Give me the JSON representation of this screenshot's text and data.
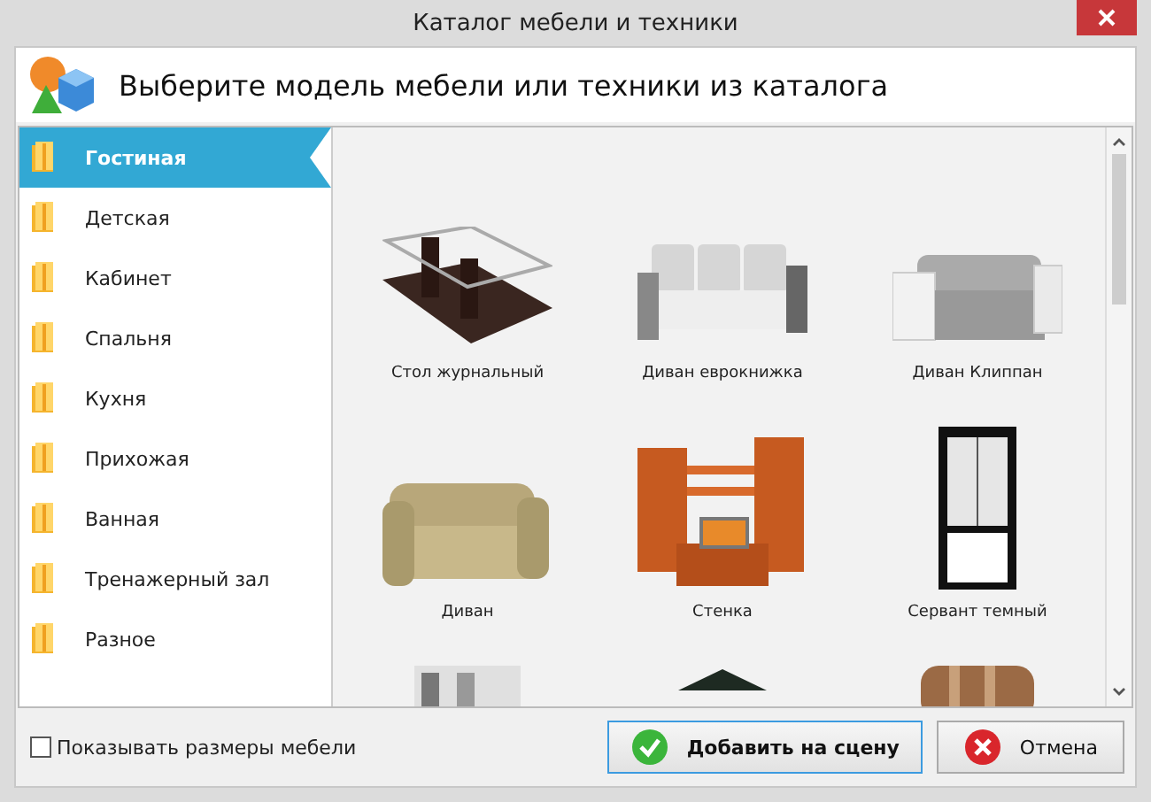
{
  "window": {
    "title": "Каталог мебели и техники"
  },
  "header": {
    "title": "Выберите модель мебели или техники из каталога"
  },
  "sidebar": {
    "items": [
      {
        "label": "Гостиная",
        "selected": true
      },
      {
        "label": "Детская",
        "selected": false
      },
      {
        "label": "Кабинет",
        "selected": false
      },
      {
        "label": "Спальня",
        "selected": false
      },
      {
        "label": "Кухня",
        "selected": false
      },
      {
        "label": "Прихожая",
        "selected": false
      },
      {
        "label": "Ванная",
        "selected": false
      },
      {
        "label": "Тренажерный зал",
        "selected": false
      },
      {
        "label": "Разное",
        "selected": false
      }
    ]
  },
  "catalog": {
    "items": [
      {
        "kind": "table",
        "label": "Стол журнальный"
      },
      {
        "kind": "sofa",
        "label": "Диван еврокнижка"
      },
      {
        "kind": "white-sofa",
        "label": "Диван Клиппан"
      },
      {
        "kind": "beige-sofa",
        "label": "Диван"
      },
      {
        "kind": "wall-unit",
        "label": "Стенка"
      },
      {
        "kind": "cabinet",
        "label": "Сервант темный"
      },
      {
        "kind": "white-cabinet"
      },
      {
        "kind": "dark-table"
      },
      {
        "kind": "armchair"
      }
    ]
  },
  "footer": {
    "show_sizes": {
      "label": "Показывать размеры мебели",
      "checked": false
    },
    "add_button": "Добавить на сцену",
    "cancel_button": "Отмена"
  }
}
